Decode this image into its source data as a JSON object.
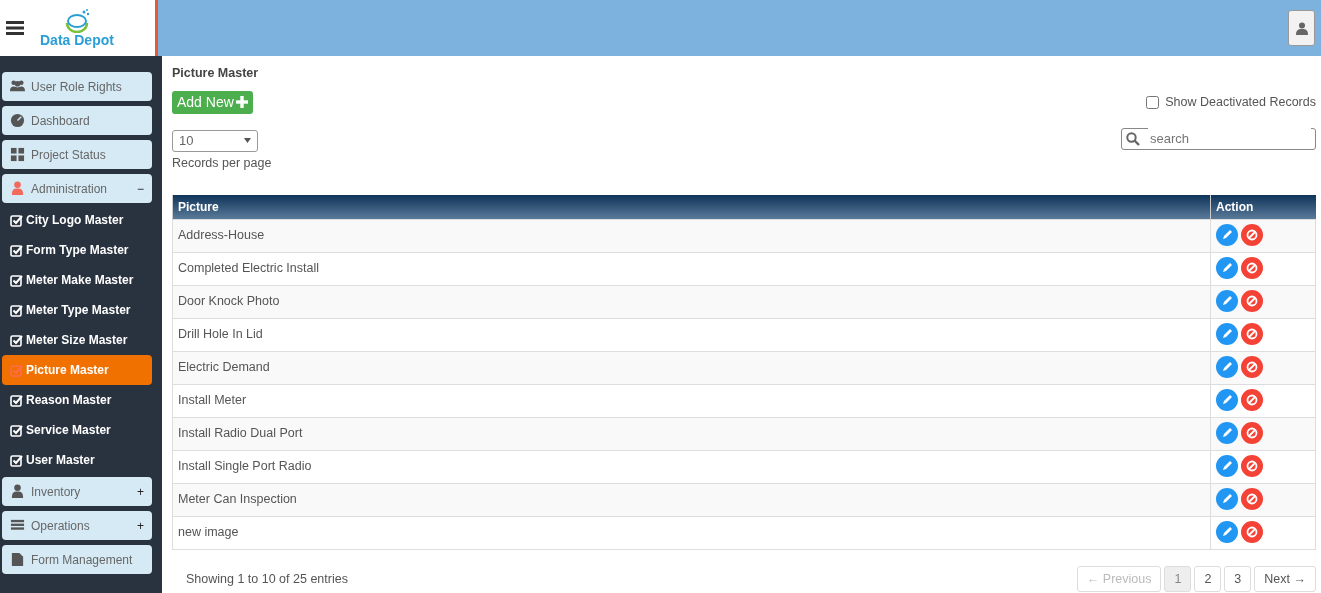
{
  "header": {
    "logo_text": "Data Depot"
  },
  "sidebar": {
    "items": [
      {
        "kind": "section",
        "label": "User Role Rights",
        "selected": false
      },
      {
        "kind": "section",
        "label": "Dashboard",
        "selected": false
      },
      {
        "kind": "section",
        "label": "Project Status",
        "selected": false
      },
      {
        "kind": "section",
        "label": "Administration",
        "toggle": "−",
        "selected": false,
        "children": [
          {
            "label": "City Logo Master",
            "selected": false
          },
          {
            "label": "Form Type Master",
            "selected": false
          },
          {
            "label": "Meter Make Master",
            "selected": false
          },
          {
            "label": "Meter Type Master",
            "selected": false
          },
          {
            "label": "Meter Size Master",
            "selected": false
          },
          {
            "label": "Picture Master",
            "selected": true
          },
          {
            "label": "Reason Master",
            "selected": false
          },
          {
            "label": "Service Master",
            "selected": false
          },
          {
            "label": "User Master",
            "selected": false
          }
        ]
      },
      {
        "kind": "section",
        "label": "Inventory",
        "toggle": "+",
        "selected": false
      },
      {
        "kind": "section",
        "label": "Operations",
        "toggle": "+",
        "selected": false
      },
      {
        "kind": "section",
        "label": "Form Management",
        "selected": false
      }
    ]
  },
  "page": {
    "title": "Picture Master",
    "add_button": "Add New",
    "show_deactivated": {
      "label": "Show Deactivated Records",
      "checked": false
    },
    "page_size": {
      "value": "10",
      "caption": "Records per page"
    },
    "search": {
      "placeholder": "search"
    }
  },
  "table": {
    "columns": [
      "Picture",
      "Action"
    ],
    "rows": [
      "Address-House",
      "Completed Electric Install",
      "Door Knock Photo",
      "Drill Hole In Lid",
      "Electric Demand",
      "Install Meter",
      "Install Radio Dual Port",
      "Install Single Port Radio",
      "Meter Can Inspection",
      "new image"
    ]
  },
  "footer": {
    "info": "Showing 1 to 10 of 25 entries",
    "pagination": [
      {
        "label": "← Previous",
        "disabled": true,
        "selected": false
      },
      {
        "label": "1",
        "disabled": false,
        "selected": true
      },
      {
        "label": "2",
        "disabled": false,
        "selected": false
      },
      {
        "label": "3",
        "disabled": false,
        "selected": false
      },
      {
        "label": "Next →",
        "disabled": false,
        "selected": false
      }
    ]
  }
}
